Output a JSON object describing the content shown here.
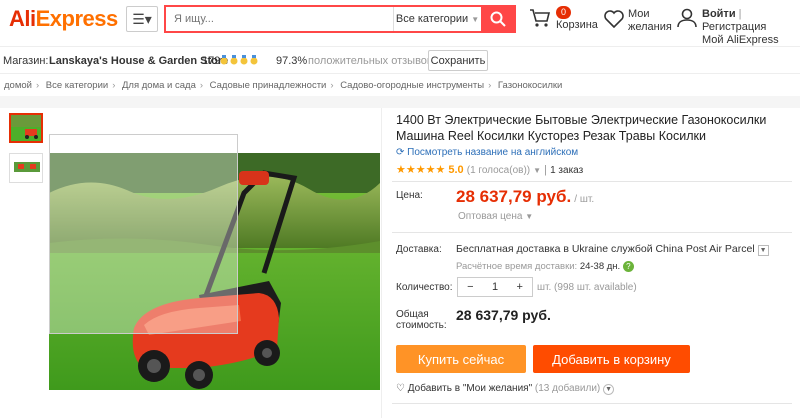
{
  "header": {
    "logo_ali": "Ali",
    "logo_express": "Express",
    "search_placeholder": "Я ищу...",
    "category": "Все категории",
    "cart_count": "0",
    "cart_label": "Корзина",
    "wishlist_line1": "Мои",
    "wishlist_line2": "желания",
    "login": "Войти",
    "register": "Регистрация",
    "my_ali": "Мой AliExpress"
  },
  "store": {
    "label": "Магазин:",
    "name": "Lanskaya's House & Garden Store",
    "score": "179",
    "feedback_pct": "97.3%",
    "feedback_label": "положительных отзывов",
    "save": "Сохранить"
  },
  "breadcrumbs": [
    "домой",
    "Все категории",
    "Для дома и сада",
    "Садовые принадлежности",
    "Садово-огородные инструменты",
    "Газонокосилки"
  ],
  "product": {
    "title": "1400 Вт Электрические Бытовые Электрические Газонокосилки Машина Reel Косилки Кусторез Резак Травы Косилки",
    "translate": "Посмотреть название на английском",
    "rating": "5.0",
    "votes": "(1 голоса(ов))",
    "orders": "1 заказ",
    "price_label": "Цена:",
    "price": "28 637,79 руб.",
    "per_unit": "/ шт.",
    "wholesale": "Оптовая цена",
    "delivery_label": "Доставка:",
    "delivery_text": "Бесплатная доставка в Ukraine службой China Post Air Parcel",
    "delivery_time_label": "Расчётное время доставки:",
    "delivery_time": "24-38 дн.",
    "qty_label": "Количество:",
    "qty_minus": "−",
    "qty_value": "1",
    "qty_plus": "+",
    "stock": "шт. (998 шт. available)",
    "total_label_1": "Общая",
    "total_label_2": "стоимость:",
    "total": "28 637,79 руб.",
    "buy_now": "Купить сейчас",
    "add_cart": "Добавить в корзину",
    "wish_add": "Добавить в \"Мои желания\"",
    "wish_count": "(13 добавили)"
  },
  "colors": {
    "brand": "#e62e04",
    "buy": "#ff9326",
    "cart": "#ff4c00"
  }
}
